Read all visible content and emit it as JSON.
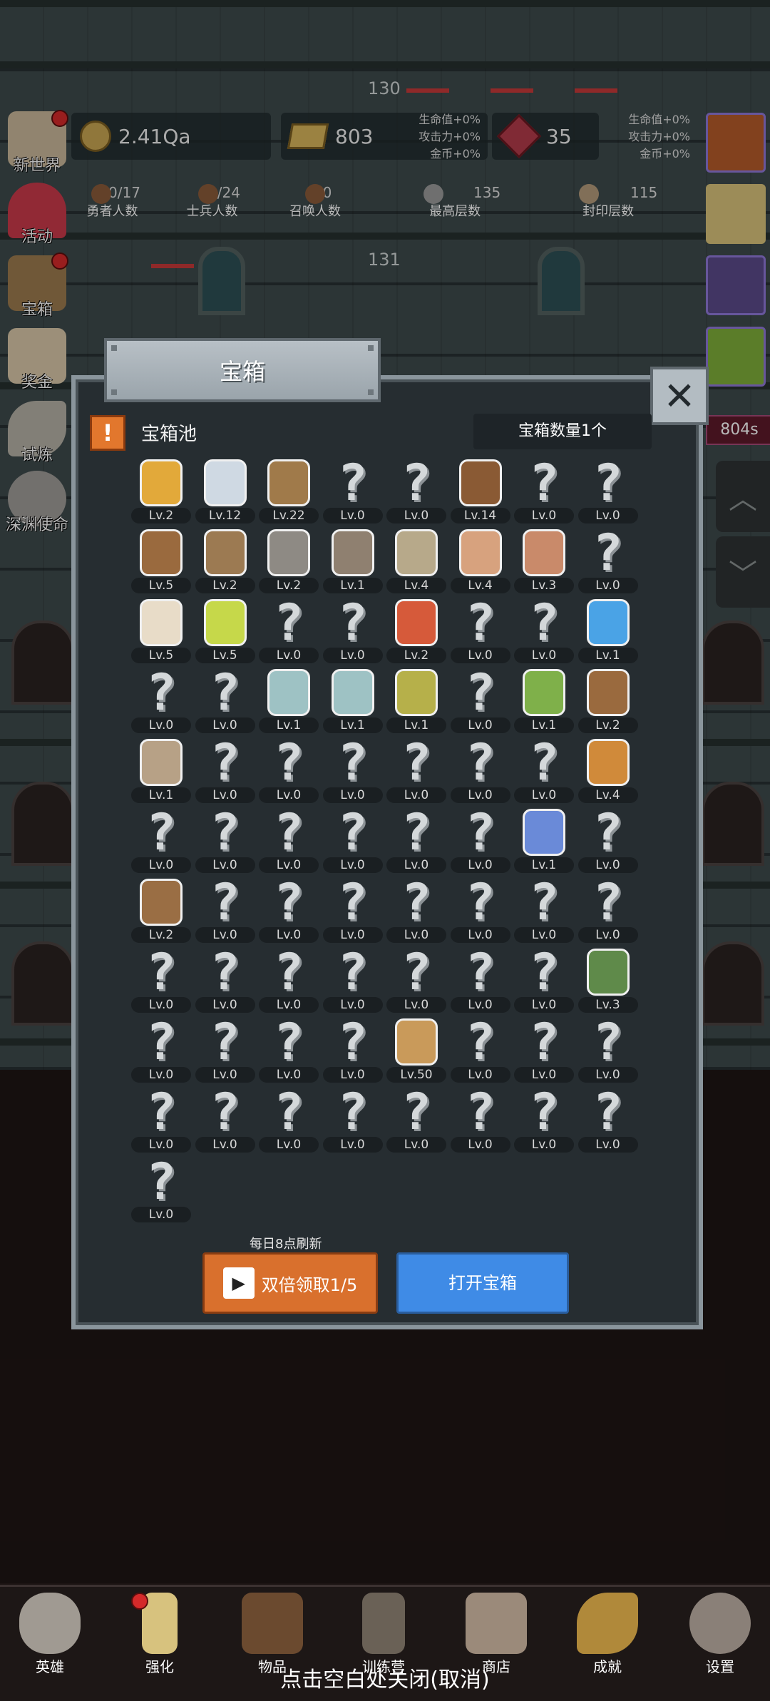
{
  "hud": {
    "gold": "2.41Qa",
    "bars": "803",
    "gems": "35",
    "bonus_left": [
      "生命值+0%",
      "攻击力+0%",
      "金币+0%"
    ],
    "bonus_right": [
      "生命值+0%",
      "攻击力+0%",
      "金币+0%"
    ],
    "counts": [
      {
        "value": "0/17",
        "label": "勇者人数"
      },
      {
        "value": "2/24",
        "label": "士兵人数"
      },
      {
        "value": "0",
        "label": "召唤人数"
      },
      {
        "value": "135",
        "label": "最高层数"
      },
      {
        "value": "115",
        "label": "封印层数"
      }
    ],
    "floor_top": "130",
    "floor_mid": "131"
  },
  "side_left": [
    "新世界",
    "活动",
    "宝箱",
    "奖金",
    "试炼",
    "深渊使命"
  ],
  "side_right_timer": "804s",
  "dialog": {
    "title": "宝箱",
    "close": "✕",
    "warn": "!",
    "pool_title": "宝箱池",
    "chest_count": "宝箱数量1个",
    "refresh_note": "每日8点刷新",
    "double_button": "双倍领取1/5",
    "open_button": "打开宝箱"
  },
  "items": [
    {
      "icon": "crown-icon",
      "lv": "Lv.2"
    },
    {
      "icon": "diamond-icon",
      "lv": "Lv.12"
    },
    {
      "icon": "wooden-sword-icon",
      "lv": "Lv.22"
    },
    {
      "icon": "unknown-icon",
      "lv": "Lv.0"
    },
    {
      "icon": "unknown-icon",
      "lv": "Lv.0"
    },
    {
      "icon": "leather-armor-icon",
      "lv": "Lv.14"
    },
    {
      "icon": "unknown-icon",
      "lv": "Lv.0"
    },
    {
      "icon": "unknown-icon",
      "lv": "Lv.0"
    },
    {
      "icon": "leather-helmet-icon",
      "lv": "Lv.5"
    },
    {
      "icon": "dagger-icon",
      "lv": "Lv.2"
    },
    {
      "icon": "iron-helmet-icon",
      "lv": "Lv.2"
    },
    {
      "icon": "hammer-icon",
      "lv": "Lv.1"
    },
    {
      "icon": "knight-helmet-icon",
      "lv": "Lv.4"
    },
    {
      "icon": "meat-icon",
      "lv": "Lv.4"
    },
    {
      "icon": "steak-icon",
      "lv": "Lv.3"
    },
    {
      "icon": "unknown-icon",
      "lv": "Lv.0"
    },
    {
      "icon": "rice-bowl-icon",
      "lv": "Lv.5"
    },
    {
      "icon": "yellow-potion-icon",
      "lv": "Lv.5"
    },
    {
      "icon": "unknown-icon",
      "lv": "Lv.0"
    },
    {
      "icon": "unknown-icon",
      "lv": "Lv.0"
    },
    {
      "icon": "red-potion-icon",
      "lv": "Lv.2"
    },
    {
      "icon": "unknown-icon",
      "lv": "Lv.0"
    },
    {
      "icon": "unknown-icon",
      "lv": "Lv.0"
    },
    {
      "icon": "blue-potion-icon",
      "lv": "Lv.1"
    },
    {
      "icon": "unknown-icon",
      "lv": "Lv.0"
    },
    {
      "icon": "unknown-icon",
      "lv": "Lv.0"
    },
    {
      "icon": "glass-bottle-icon",
      "lv": "Lv.1"
    },
    {
      "icon": "glass-bottle-icon",
      "lv": "Lv.1"
    },
    {
      "icon": "olive-bottle-icon",
      "lv": "Lv.1"
    },
    {
      "icon": "unknown-icon",
      "lv": "Lv.0"
    },
    {
      "icon": "winged-boot-icon",
      "lv": "Lv.1"
    },
    {
      "icon": "leather-boot-icon",
      "lv": "Lv.2"
    },
    {
      "icon": "cloth-boot-icon",
      "lv": "Lv.1"
    },
    {
      "icon": "unknown-icon",
      "lv": "Lv.0"
    },
    {
      "icon": "unknown-icon",
      "lv": "Lv.0"
    },
    {
      "icon": "unknown-icon",
      "lv": "Lv.0"
    },
    {
      "icon": "unknown-icon",
      "lv": "Lv.0"
    },
    {
      "icon": "unknown-icon",
      "lv": "Lv.0"
    },
    {
      "icon": "unknown-icon",
      "lv": "Lv.0"
    },
    {
      "icon": "torch-icon",
      "lv": "Lv.4"
    },
    {
      "icon": "unknown-icon",
      "lv": "Lv.0"
    },
    {
      "icon": "unknown-icon",
      "lv": "Lv.0"
    },
    {
      "icon": "unknown-icon",
      "lv": "Lv.0"
    },
    {
      "icon": "unknown-icon",
      "lv": "Lv.0"
    },
    {
      "icon": "unknown-icon",
      "lv": "Lv.0"
    },
    {
      "icon": "unknown-icon",
      "lv": "Lv.0"
    },
    {
      "icon": "magic-wand-icon",
      "lv": "Lv.1"
    },
    {
      "icon": "unknown-icon",
      "lv": "Lv.0"
    },
    {
      "icon": "backpack-icon",
      "lv": "Lv.2"
    },
    {
      "icon": "unknown-icon",
      "lv": "Lv.0"
    },
    {
      "icon": "unknown-icon",
      "lv": "Lv.0"
    },
    {
      "icon": "unknown-icon",
      "lv": "Lv.0"
    },
    {
      "icon": "unknown-icon",
      "lv": "Lv.0"
    },
    {
      "icon": "unknown-icon",
      "lv": "Lv.0"
    },
    {
      "icon": "unknown-icon",
      "lv": "Lv.0"
    },
    {
      "icon": "unknown-icon",
      "lv": "Lv.0"
    },
    {
      "icon": "unknown-icon",
      "lv": "Lv.0"
    },
    {
      "icon": "unknown-icon",
      "lv": "Lv.0"
    },
    {
      "icon": "unknown-icon",
      "lv": "Lv.0"
    },
    {
      "icon": "unknown-icon",
      "lv": "Lv.0"
    },
    {
      "icon": "unknown-icon",
      "lv": "Lv.0"
    },
    {
      "icon": "unknown-icon",
      "lv": "Lv.0"
    },
    {
      "icon": "unknown-icon",
      "lv": "Lv.0"
    },
    {
      "icon": "emblem-icon",
      "lv": "Lv.3"
    },
    {
      "icon": "unknown-icon",
      "lv": "Lv.0"
    },
    {
      "icon": "unknown-icon",
      "lv": "Lv.0"
    },
    {
      "icon": "unknown-icon",
      "lv": "Lv.0"
    },
    {
      "icon": "unknown-icon",
      "lv": "Lv.0"
    },
    {
      "icon": "beer-mug-icon",
      "lv": "Lv.50"
    },
    {
      "icon": "unknown-icon",
      "lv": "Lv.0"
    },
    {
      "icon": "unknown-icon",
      "lv": "Lv.0"
    },
    {
      "icon": "unknown-icon",
      "lv": "Lv.0"
    },
    {
      "icon": "unknown-icon",
      "lv": "Lv.0"
    },
    {
      "icon": "unknown-icon",
      "lv": "Lv.0"
    },
    {
      "icon": "unknown-icon",
      "lv": "Lv.0"
    },
    {
      "icon": "unknown-icon",
      "lv": "Lv.0"
    },
    {
      "icon": "unknown-icon",
      "lv": "Lv.0"
    },
    {
      "icon": "unknown-icon",
      "lv": "Lv.0"
    },
    {
      "icon": "unknown-icon",
      "lv": "Lv.0"
    },
    {
      "icon": "unknown-icon",
      "lv": "Lv.0"
    },
    {
      "icon": "unknown-icon",
      "lv": "Lv.0"
    }
  ],
  "bottom_nav": [
    "英雄",
    "强化",
    "物品",
    "训练营",
    "商店",
    "成就",
    "设置"
  ],
  "close_hint": "点击空白处关闭(取消)"
}
